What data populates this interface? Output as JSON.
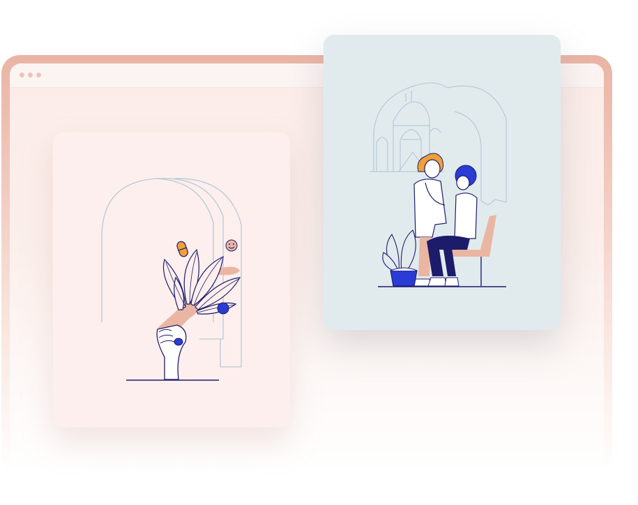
{
  "colors": {
    "frame": "#eab4a4",
    "window_inner": "#fbece8",
    "card_pink": "#fdefed",
    "card_blue": "#e1ebee",
    "line_blue": "#b9c9d6",
    "ink": "#1c1c6b",
    "accent_blue": "#2a3bd6",
    "accent_orange": "#f0a03a",
    "accent_peach": "#eab6a2"
  },
  "illustrations": {
    "left": "hand-holding-bouquet-arch",
    "right": "doctor-examining-patient-with-stethoscope"
  }
}
